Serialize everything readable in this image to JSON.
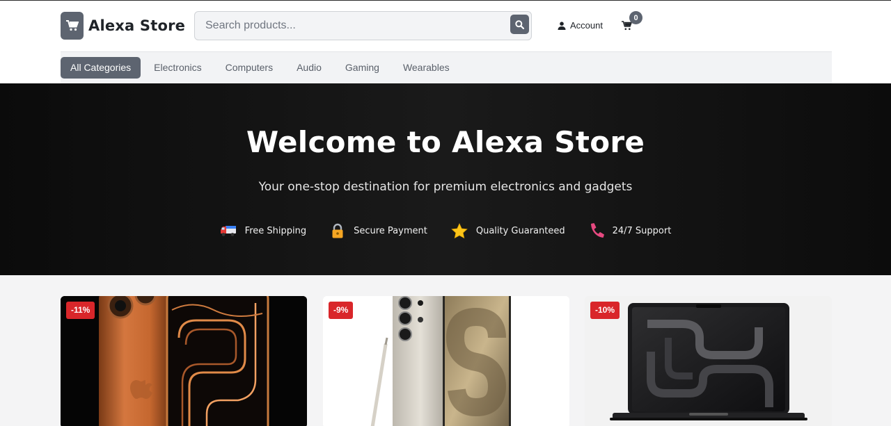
{
  "brand": {
    "name": "Alexa Store",
    "icon": "cart-icon"
  },
  "search": {
    "placeholder": "Search products...",
    "value": "",
    "button_icon": "search-icon"
  },
  "header": {
    "account_label": "Account",
    "cart_count": "0"
  },
  "categories": [
    {
      "label": "All Categories",
      "active": true
    },
    {
      "label": "Electronics",
      "active": false
    },
    {
      "label": "Computers",
      "active": false
    },
    {
      "label": "Audio",
      "active": false
    },
    {
      "label": "Gaming",
      "active": false
    },
    {
      "label": "Wearables",
      "active": false
    }
  ],
  "hero": {
    "title": "Welcome to Alexa Store",
    "subtitle": "Your one-stop destination for premium electronics and gadgets",
    "features": [
      {
        "icon": "truck-icon",
        "label": "Free Shipping"
      },
      {
        "icon": "lock-icon",
        "label": "Secure Payment"
      },
      {
        "icon": "star-icon",
        "label": "Quality Guaranteed"
      },
      {
        "icon": "phone-icon",
        "label": "24/7 Support"
      }
    ]
  },
  "products": [
    {
      "discount": "-11%",
      "image": "orange-smartphone-image"
    },
    {
      "discount": "-9%",
      "image": "silver-smartphone-with-stylus-image"
    },
    {
      "discount": "-10%",
      "image": "black-laptop-image"
    }
  ],
  "colors": {
    "accent": "#5d6470",
    "badge": "#d9262a",
    "hero_bg": "#111111"
  }
}
